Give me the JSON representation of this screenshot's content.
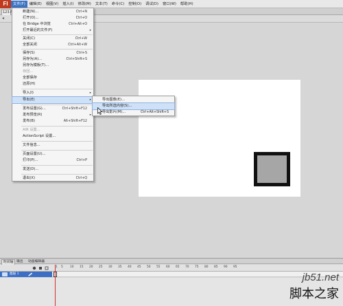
{
  "app": {
    "logo": "Fl"
  },
  "menubar": {
    "items": [
      "文件(F)",
      "编辑(E)",
      "视图(V)",
      "插入(I)",
      "修改(M)",
      "文本(T)",
      "命令(C)",
      "控制(O)",
      "调试(D)",
      "窗口(W)",
      "帮助(H)"
    ]
  },
  "document": {
    "tab": "123.fl"
  },
  "file_menu": {
    "items": [
      {
        "label": "新建(N)...",
        "shortcut": "Ctrl+N"
      },
      {
        "label": "打开(O)...",
        "shortcut": "Ctrl+O"
      },
      {
        "label": "在 Bridge 中浏览",
        "shortcut": "Ctrl+Alt+O"
      },
      {
        "label": "打开最近的文件(F)",
        "shortcut": ""
      },
      {
        "label": "关闭(C)",
        "shortcut": "Ctrl+W"
      },
      {
        "label": "全部关闭",
        "shortcut": "Ctrl+Alt+W"
      },
      {
        "label": "保存(S)",
        "shortcut": "Ctrl+S"
      },
      {
        "label": "另存为(A)...",
        "shortcut": "Ctrl+Shift+S"
      },
      {
        "label": "另存为模板(T)...",
        "shortcut": ""
      },
      {
        "label": "存回...",
        "shortcut": ""
      },
      {
        "label": "全部保存",
        "shortcut": ""
      },
      {
        "label": "还原(H)",
        "shortcut": ""
      },
      {
        "label": "导入(I)",
        "shortcut": ""
      },
      {
        "label": "导出(E)",
        "shortcut": ""
      },
      {
        "label": "发布设置(G)...",
        "shortcut": "Ctrl+Shift+F12"
      },
      {
        "label": "发布预览(R)",
        "shortcut": ""
      },
      {
        "label": "发布(B)",
        "shortcut": "Alt+Shift+F12"
      },
      {
        "label": "AIR 设置...",
        "shortcut": ""
      },
      {
        "label": "ActionScript 设置...",
        "shortcut": ""
      },
      {
        "label": "文件信息...",
        "shortcut": ""
      },
      {
        "label": "页面设置(U)...",
        "shortcut": ""
      },
      {
        "label": "打印(P)...",
        "shortcut": "Ctrl+P"
      },
      {
        "label": "发送(D)...",
        "shortcut": ""
      },
      {
        "label": "退出(X)",
        "shortcut": "Ctrl+Q"
      }
    ]
  },
  "export_submenu": {
    "items": [
      {
        "label": "导出图像(E)...",
        "shortcut": ""
      },
      {
        "label": "导出所选内容(S)...",
        "shortcut": ""
      },
      {
        "label": "导出影片(M)...",
        "shortcut": "Ctrl+Alt+Shift+S"
      }
    ]
  },
  "timeline": {
    "tabs": [
      "时间轴",
      "输出",
      "动画编辑器"
    ],
    "ruler": [
      "1",
      "5",
      "10",
      "15",
      "20",
      "25",
      "30",
      "35",
      "40",
      "45",
      "50",
      "55",
      "60",
      "65",
      "70",
      "75",
      "80",
      "85",
      "90",
      "95"
    ],
    "layer_name": "图层 1"
  },
  "watermark": {
    "url": "jb51.net",
    "text": "脚本之家"
  },
  "colors": {
    "menu_highlight": "#cfe1f7",
    "menubar_active": "#3a73c4",
    "logo": "#c03a1e",
    "layer_selected": "#3c6fc4"
  }
}
